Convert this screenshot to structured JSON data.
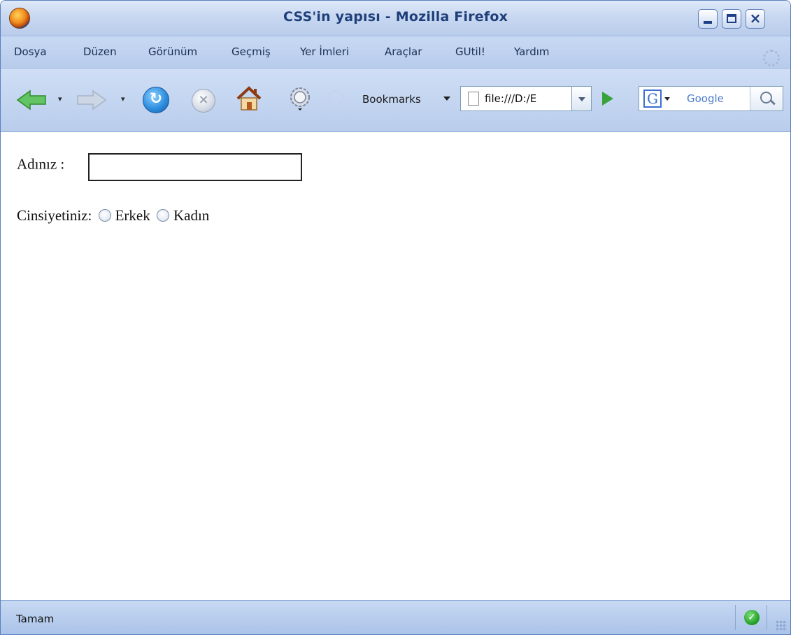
{
  "window": {
    "title": "CSS'in yapısı - Mozilla Firefox"
  },
  "menu": {
    "items": [
      "Dosya",
      "Düzen",
      "Görünüm",
      "Geçmiş",
      "Yer İmleri",
      "Araçlar",
      "GUtil!",
      "Yardım"
    ]
  },
  "toolbar": {
    "bookmarks_label": "Bookmarks",
    "url": "file:///D:/E",
    "search_placeholder": "Google",
    "search_engine_letter": "G"
  },
  "form": {
    "name_label": "Adınız :",
    "name_value": "",
    "gender_label": "Cinsiyetiniz:",
    "gender_options": [
      "Erkek",
      "Kadın"
    ]
  },
  "status": {
    "text": "Tamam"
  },
  "colors": {
    "title_text": "#1f3f7a",
    "chrome_blue": "#b9cdec",
    "go_green": "#3aa23a",
    "ok_green": "#1f9a1f"
  }
}
